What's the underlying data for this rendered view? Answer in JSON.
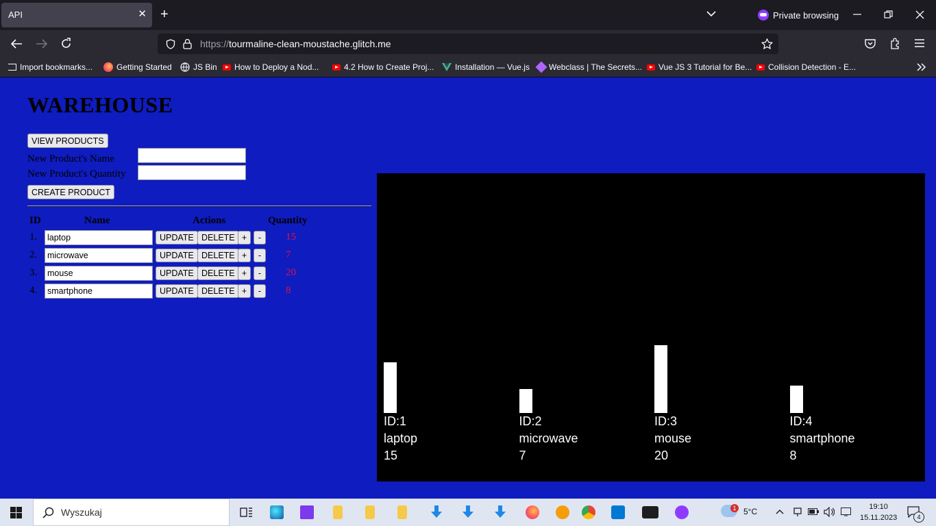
{
  "browser": {
    "tab_title": "API",
    "tab_close": "✕",
    "new_tab": "+",
    "private_label": "Private browsing",
    "url_prefix": "https://",
    "url_host": "tourmaline-clean-moustache.glitch.me"
  },
  "bookmarks": [
    {
      "label": "Import bookmarks...",
      "icon": "import-icon"
    },
    {
      "label": "Getting Started",
      "icon": "firefox-icon"
    },
    {
      "label": "JS Bin",
      "icon": "globe-icon"
    },
    {
      "label": "How to Deploy a Nod...",
      "icon": "youtube-icon"
    },
    {
      "label": "4.2 How to Create Proj...",
      "icon": "youtube-icon"
    },
    {
      "label": "Installation — Vue.js",
      "icon": "vue-icon"
    },
    {
      "label": "Webclass | The Secrets...",
      "icon": "webclass-icon"
    },
    {
      "label": "Vue JS 3 Tutorial for Be...",
      "icon": "youtube-icon"
    },
    {
      "label": "Collision Detection - E...",
      "icon": "youtube-icon"
    }
  ],
  "page": {
    "title": "WAREHOUSE",
    "view_products": "VIEW PRODUCTS",
    "new_name_label": "New Product's Name",
    "new_qty_label": "New Product's Quantity",
    "new_name_value": "",
    "new_qty_value": "",
    "create_product": "CREATE PRODUCT",
    "headers": {
      "id": "ID",
      "name": "Name",
      "actions": "Actions",
      "quantity": "Quantity"
    },
    "update_label": "UPDATE",
    "delete_label": "DELETE",
    "plus_label": "+",
    "minus_label": "-",
    "rows": [
      {
        "num": "1.",
        "name": "laptop",
        "qty": "15"
      },
      {
        "num": "2.",
        "name": "microwave",
        "qty": "7"
      },
      {
        "num": "3.",
        "name": "mouse",
        "qty": "20"
      },
      {
        "num": "4.",
        "name": "smartphone",
        "qty": "8"
      }
    ]
  },
  "chart_data": {
    "type": "bar",
    "categories": [
      "laptop",
      "microwave",
      "mouse",
      "smartphone"
    ],
    "ids": [
      "ID:1",
      "ID:2",
      "ID:3",
      "ID:4"
    ],
    "values": [
      15,
      7,
      20,
      8
    ],
    "value_labels": [
      "15",
      "7",
      "20",
      "8"
    ],
    "title": "",
    "xlabel": "",
    "ylabel": "",
    "bar_color": "#ffffff",
    "background": "#000000"
  },
  "taskbar": {
    "search_placeholder": "Wyszukaj",
    "weather": "5°C",
    "weather_badge": "1",
    "time": "19:10",
    "date": "15.11.2023",
    "notif_count": "4"
  },
  "colors": {
    "page_bg": "#0f1cbf",
    "quantity_text": "#e0144c"
  }
}
